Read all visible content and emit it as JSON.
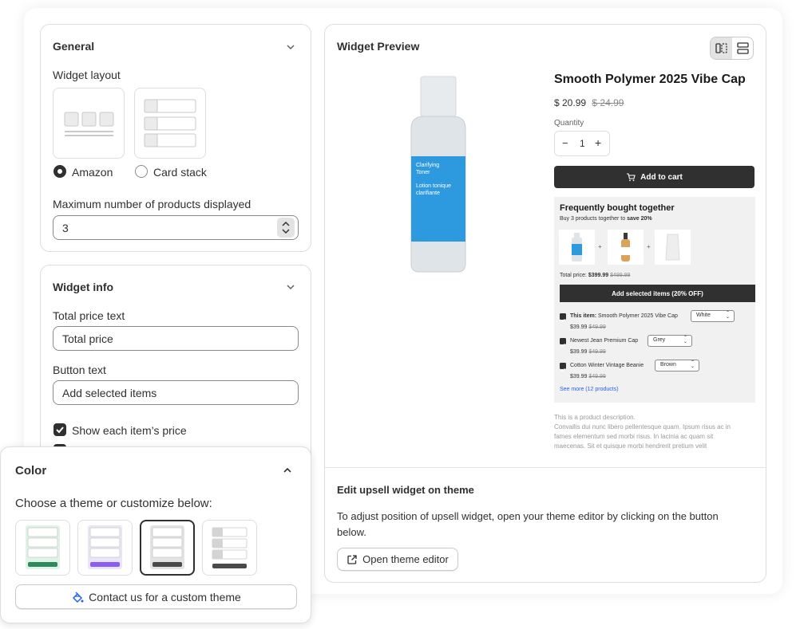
{
  "general": {
    "title": "General",
    "layout_label": "Widget layout",
    "options": [
      "Amazon",
      "Card stack"
    ],
    "selected_option": "Amazon",
    "max_label": "Maximum number of products displayed",
    "max_value": "3"
  },
  "widget_info": {
    "title": "Widget info",
    "total_price_label": "Total price text",
    "total_price_value": "Total price",
    "button_text_label": "Button text",
    "button_text_value": "Add selected items",
    "show_price_label": "Show each item’s price"
  },
  "color": {
    "title": "Color",
    "subtitle": "Choose a theme or customize below:",
    "themes": [
      {
        "accent": "#2e8a5a",
        "tint": "#dff3e6"
      },
      {
        "accent": "#8b5cf6",
        "tint": "#ebe6f7"
      },
      {
        "accent": "#4a4a4a",
        "tint": "#e3e3e3"
      },
      {
        "accent": "#4a4a4a",
        "tint": "#ffffff"
      }
    ],
    "selected_theme": 3,
    "contact_button": "Contact us for a custom theme"
  },
  "preview": {
    "title": "Widget Preview",
    "bottle_text1": "Clarifying",
    "bottle_text2": "Toner",
    "bottle_text3": "Lotion tonique",
    "bottle_text4": "clarifiante",
    "product_title": "Smooth Polymer 2025 Vibe Cap",
    "price": "$ 20.99",
    "compare_price": "$ 24.99",
    "quantity_label": "Quantity",
    "quantity_minus": "−",
    "quantity_plus": "+",
    "quantity_value": "1",
    "add_to_cart": "Add to cart",
    "fbt": {
      "title": "Frequently bought together",
      "subtitle_prefix": "Buy 3 products together to ",
      "subtitle_strong": "save 20%",
      "total_label": "Total price:",
      "total_price": "$399.99",
      "total_compare": "$499.99",
      "button": "Add selected items (20% OFF)",
      "this_item_prefix": "This item:",
      "items": [
        {
          "name": "Smooth Polymer 2025 Vibe Cap",
          "variant": "White",
          "price": "$39.99",
          "compare": "$49.99"
        },
        {
          "name": "Newest Jean Premium Cap",
          "variant": "Grey",
          "price": "$39.99",
          "compare": "$49.99"
        },
        {
          "name": "Cotton Winter Vintage Beanie",
          "variant": "Brown",
          "price": "$39.99",
          "compare": "$49.99"
        }
      ],
      "see_more": "See more (12 products)"
    },
    "description": [
      "This is a product description.",
      "Convallis dui nunc libero pellentesque quam. Ipsum risus ac in",
      "fames elementum sed morbi risus. In lacinia ac quam sit",
      "maecenas. Sit et quisque morbi hendrerit pretium velit"
    ]
  },
  "edit_section": {
    "title": "Edit upsell widget on theme",
    "body_line1": "To adjust position of upsell widget, open your theme editor by clicking on the button",
    "body_line2": "below.",
    "button": "Open theme editor"
  },
  "colors": {
    "dark": "#303030",
    "bottle_label": "#2d9ae0",
    "link": "#2463eb"
  }
}
